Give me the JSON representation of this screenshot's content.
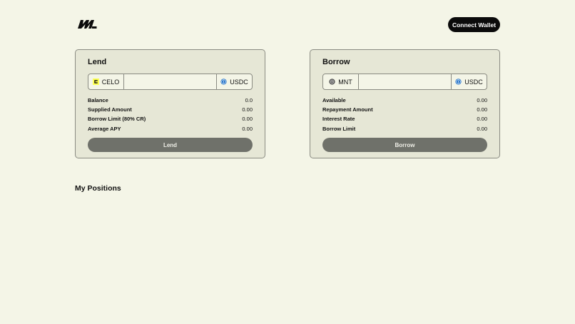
{
  "header": {
    "logo_icon": "brand-logo-icon",
    "connect_label": "Connect Wallet"
  },
  "lend": {
    "title": "Lend",
    "from_token": {
      "symbol": "CELO",
      "icon": "celo-token-icon",
      "color": "#fcff52"
    },
    "amount_value": "",
    "to_token": {
      "symbol": "USDC",
      "icon": "usdc-token-icon",
      "color": "#2775ca"
    },
    "stats": [
      {
        "label": "Balance",
        "value": "0.0"
      },
      {
        "label": "Supplied Amount",
        "value": "0.00"
      },
      {
        "label": "Borrow Limit (80% CR)",
        "value": "0.00"
      },
      {
        "label": "Average APY",
        "value": "0.00"
      }
    ],
    "action_label": "Lend"
  },
  "borrow": {
    "title": "Borrow",
    "from_token": {
      "symbol": "MNT",
      "icon": "mnt-token-icon",
      "color": "#555555"
    },
    "amount_value": "",
    "to_token": {
      "symbol": "USDC",
      "icon": "usdc-token-icon",
      "color": "#2775ca"
    },
    "stats": [
      {
        "label": "Available",
        "value": "0.00"
      },
      {
        "label": "Repayment Amount",
        "value": "0.00"
      },
      {
        "label": "Interest Rate",
        "value": "0.00"
      },
      {
        "label": "Borrow Limit",
        "value": "0.00"
      }
    ],
    "action_label": "Borrow"
  },
  "positions": {
    "title": "My Positions"
  }
}
